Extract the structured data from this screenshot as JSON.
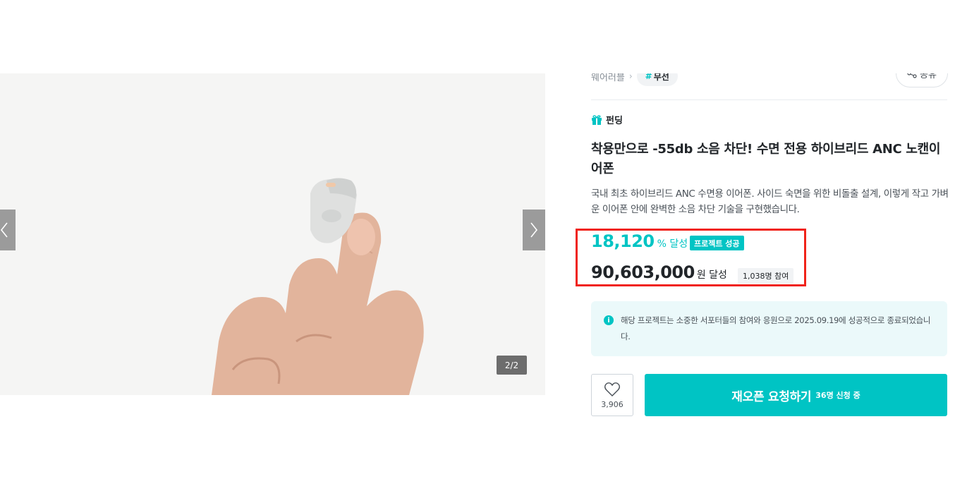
{
  "gallery": {
    "counter": "2/2",
    "prev_icon": "chevron-left-icon",
    "next_icon": "chevron-right-icon"
  },
  "breadcrumb": {
    "category": "웨어러블",
    "tag_hash": "#",
    "tag_label": "무선"
  },
  "share": {
    "label": "공유",
    "icon": "share-icon"
  },
  "project": {
    "type_label": "펀딩",
    "type_icon": "gift-icon",
    "title": "착용만으로 -55db 소음 차단! 수면 전용 하이브리드 ANC 노캔이어폰",
    "summary": "국내 최초 하이브리드 ANC 수면용 이어폰. 사이드 숙면을 위한 비돌출 설계, 이렇게 작고 가벼운 이어폰 안에 완벽한 소음 차단 기술을 구현했습니다."
  },
  "stats": {
    "rate_value": "18,120",
    "rate_unit": "% 달성",
    "success_badge": "프로젝트 성공",
    "amount_value": "90,603,000",
    "amount_unit": "원 달성",
    "backers_badge": "1,038명 참여"
  },
  "notice": {
    "icon": "info-icon",
    "text": "해당 프로젝트는 소중한 서포터들의 참여와 응원으로 2025.09.19에 성공적으로 종료되었습니다."
  },
  "actions": {
    "like_count": "3,906",
    "like_icon": "heart-icon",
    "reopen_label": "재오픈 요청하기",
    "reopen_sub": "36명 신청 중"
  },
  "colors": {
    "accent": "#00c4c4",
    "highlight_border": "#f0231a",
    "notice_bg": "#ebf9fa"
  }
}
